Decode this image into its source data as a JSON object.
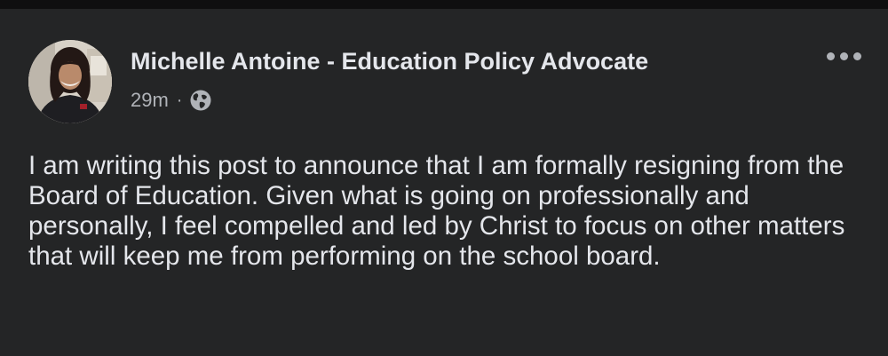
{
  "post": {
    "author_name": "Michelle Antoine - Education Policy Advocate",
    "timestamp": "29m",
    "separator": "·",
    "audience_icon": "globe-icon",
    "more_icon": "more-options-icon",
    "text": "I am writing this post to announce that I am formally resigning from the Board of Education. Given what is going on professionally and personally, I feel compelled and led by Christ to focus on other matters that will keep me from performing on the school board."
  },
  "colors": {
    "background": "#242526",
    "primary_text": "#e4e6eb",
    "secondary_text": "#b0b3b8"
  }
}
